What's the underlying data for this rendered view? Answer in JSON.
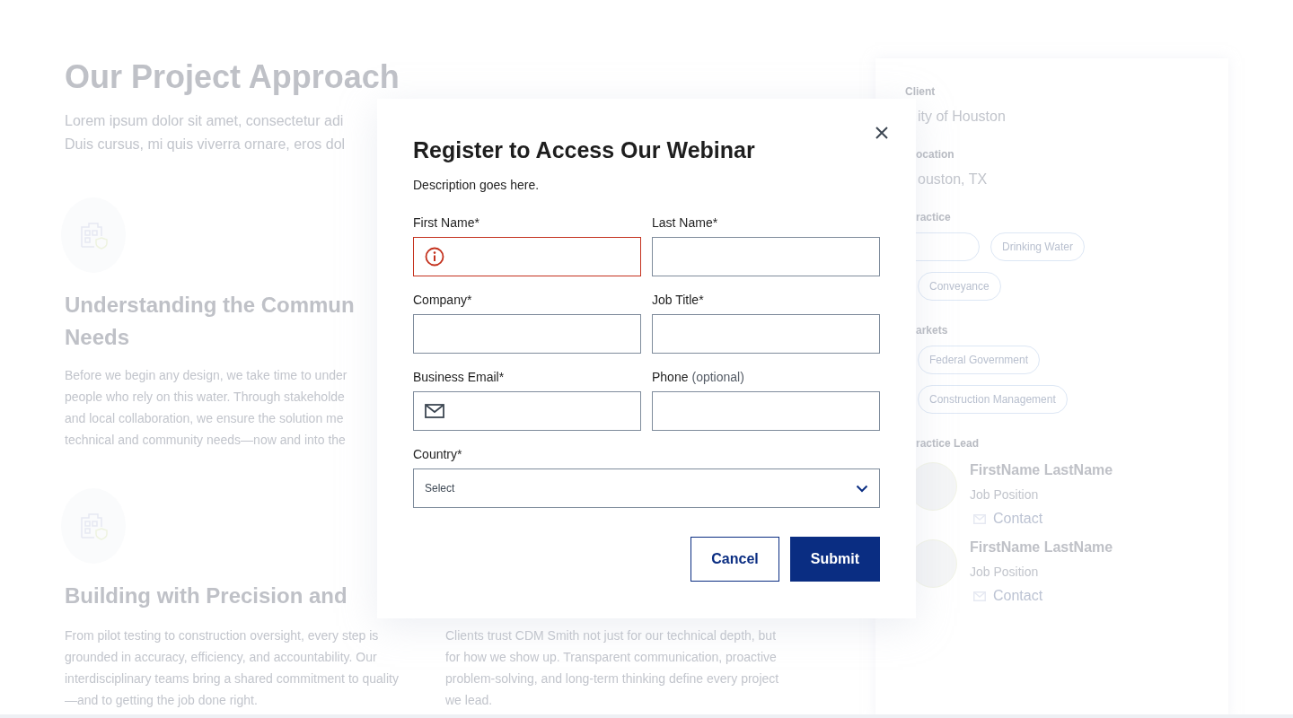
{
  "background": {
    "heading": "Our Project Approach",
    "intro_lines": [
      "Lorem ipsum dolor sit amet, consectetur adi",
      "Duis cursus, mi quis viverra ornare, eros dol"
    ],
    "sections": [
      {
        "heading_lines": [
          "Understanding the Commun",
          "Needs"
        ],
        "body_lines": [
          "Before we begin any design, we take time to under",
          "people who rely on this water. Through stakeholde",
          "and local collaboration, we ensure the solution me",
          "technical and community needs—now and into the"
        ]
      },
      {
        "heading_lines": [
          "Building with Precision and"
        ],
        "columns": [
          "From pilot testing to construction oversight, every step is grounded in accuracy, efficiency, and accountability. Our interdisciplinary teams bring a shared commitment to quality—and to getting the job done right.",
          "Clients trust CDM Smith not just for our technical depth, but for how we show up. Transparent communication, proactive problem-solving, and long-term thinking define every project we lead."
        ]
      }
    ]
  },
  "sidebar": {
    "sections": [
      {
        "kind": "text",
        "label": "Client",
        "value": "ity of Houston"
      },
      {
        "kind": "text",
        "label": "ocation",
        "value": "ouston, TX"
      },
      {
        "kind": "tags",
        "label": "ractice",
        "hidden_first_tag": true,
        "tags": [
          "Drinking Water",
          "Conveyance"
        ]
      },
      {
        "kind": "tags",
        "label": "arkets",
        "hidden_first_tag": false,
        "tags": [
          "Federal Government",
          "Construction Management"
        ]
      },
      {
        "kind": "people",
        "label": "ractice Lead",
        "people": [
          {
            "name": "FirstName LastName",
            "position": "Job Position",
            "contact": "Contact"
          },
          {
            "name": "FirstName LastName",
            "position": "Job Position",
            "contact": "Contact"
          }
        ]
      }
    ]
  },
  "modal": {
    "title": "Register to Access Our Webinar",
    "description": "Description goes here.",
    "fields": [
      {
        "label": "First Name*",
        "kind": "text",
        "error": true
      },
      {
        "label": "Last Name*",
        "kind": "text",
        "error": false
      },
      {
        "label": "Company*",
        "kind": "text",
        "error": false
      },
      {
        "label": "Job Title*",
        "kind": "text",
        "error": false
      },
      {
        "label": "Business Email*",
        "kind": "email",
        "error": false
      },
      {
        "label": "Phone",
        "note": "(optional)",
        "kind": "text",
        "error": false
      },
      {
        "label": "Country*",
        "kind": "select",
        "placeholder": "Select",
        "error": false
      }
    ],
    "buttons": [
      {
        "label": "Cancel",
        "kind": "secondary"
      },
      {
        "label": "Submit",
        "kind": "primary"
      }
    ]
  }
}
